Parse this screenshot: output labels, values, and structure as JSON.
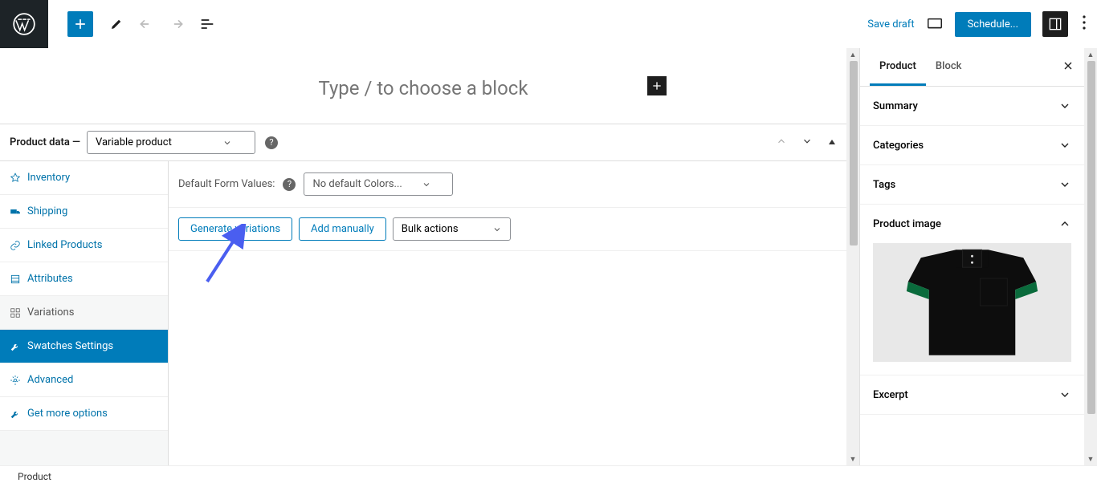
{
  "topbar": {
    "save_draft": "Save draft",
    "schedule": "Schedule..."
  },
  "editor": {
    "placeholder": "Type / to choose a block"
  },
  "product_data": {
    "label": "Product data —",
    "type_selected": "Variable product",
    "tabs": {
      "inventory": "Inventory",
      "shipping": "Shipping",
      "linked": "Linked Products",
      "attributes": "Attributes",
      "variations": "Variations",
      "swatches": "Swatches Settings",
      "advanced": "Advanced",
      "more": "Get more options"
    },
    "default_form_label": "Default Form Values:",
    "default_form_selected": "No default Colors...",
    "generate": "Generate variations",
    "add_manually": "Add manually",
    "bulk_actions": "Bulk actions"
  },
  "right_panel": {
    "tabs": {
      "product": "Product",
      "block": "Block"
    },
    "sections": {
      "summary": "Summary",
      "categories": "Categories",
      "tags": "Tags",
      "product_image": "Product image",
      "excerpt": "Excerpt"
    }
  },
  "footer": {
    "breadcrumb": "Product"
  }
}
